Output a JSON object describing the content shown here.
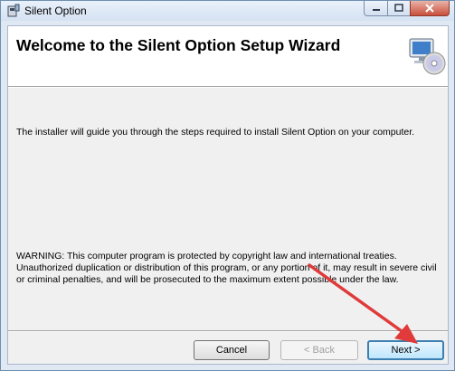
{
  "window": {
    "title": "Silent Option"
  },
  "banner": {
    "heading": "Welcome to the Silent Option Setup Wizard"
  },
  "body": {
    "intro": "The installer will guide you through the steps required to install Silent Option on your computer.",
    "warning_lines": [
      "WARNING: This computer program is protected by copyright law and international treaties.",
      "Unauthorized duplication or distribution of this program, or any portion of it, may result in severe civil",
      "or criminal penalties, and will be prosecuted to the maximum extent possible under the law."
    ]
  },
  "buttons": {
    "cancel": "Cancel",
    "back": "< Back",
    "next": "Next >"
  },
  "icons": {
    "app": "installer-icon",
    "banner": "computer-cd-icon",
    "annotation": "red-arrow-annotation"
  },
  "colors": {
    "arrow": "#e03a3a",
    "close_button": "#c94f3b",
    "default_button_border": "#3c7fb1"
  }
}
